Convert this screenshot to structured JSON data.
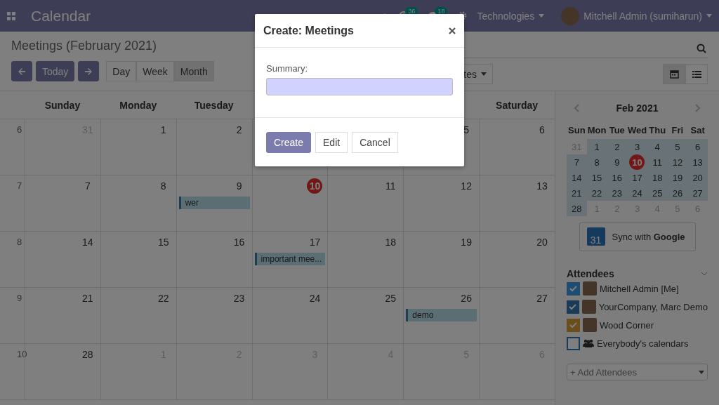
{
  "navbar": {
    "app_title": "Calendar",
    "activity_count": "36",
    "message_count": "18",
    "company": "Technologies",
    "user": "Mitchell Admin (sumiharun)"
  },
  "control_panel": {
    "title": "Meetings (February 2021)",
    "nav_buttons": [
      {
        "kind": "prev"
      },
      {
        "kind": "today",
        "label": "Today"
      },
      {
        "kind": "next"
      }
    ],
    "scales": [
      {
        "label": "Day",
        "selected": false
      },
      {
        "label": "Week",
        "selected": false
      },
      {
        "label": "Month",
        "selected": true
      }
    ],
    "filter_button": "tes",
    "views": [
      {
        "kind": "calendar",
        "selected": true
      },
      {
        "kind": "list",
        "selected": false
      }
    ]
  },
  "calendar": {
    "headers": [
      "Sunday",
      "Monday",
      "Tuesday"
    ],
    "headers_after_gap": [
      "Saturday"
    ],
    "weeks": [
      {
        "number": "6",
        "days": [
          {
            "label": "31",
            "muted": true,
            "today": false
          },
          {
            "label": "1",
            "muted": false,
            "today": false
          },
          {
            "label": "2",
            "muted": false,
            "today": false
          }
        ],
        "days_after_gap": [
          {
            "label": "5",
            "muted": false,
            "today": false
          },
          {
            "label": "6",
            "muted": false,
            "today": false
          }
        ]
      },
      {
        "number": "7",
        "days": [
          {
            "label": "7",
            "muted": false,
            "today": false
          },
          {
            "label": "8",
            "muted": false,
            "today": false
          },
          {
            "label": "9",
            "muted": false,
            "today": false,
            "events": [
              "wer"
            ]
          },
          {
            "label": "10",
            "muted": false,
            "today": true
          },
          {
            "label": "11",
            "muted": false,
            "today": false
          },
          {
            "label": "12",
            "muted": false,
            "today": false
          },
          {
            "label": "13",
            "muted": false,
            "today": false
          }
        ]
      },
      {
        "number": "8",
        "days": [
          {
            "label": "14",
            "muted": false,
            "today": false
          },
          {
            "label": "15",
            "muted": false,
            "today": false
          },
          {
            "label": "16",
            "muted": false,
            "today": false
          },
          {
            "label": "17",
            "muted": false,
            "today": false,
            "events": [
              "important mee..."
            ]
          },
          {
            "label": "18",
            "muted": false,
            "today": false
          },
          {
            "label": "19",
            "muted": false,
            "today": false
          },
          {
            "label": "20",
            "muted": false,
            "today": false
          }
        ]
      },
      {
        "number": "9",
        "days": [
          {
            "label": "21",
            "muted": false,
            "today": false
          },
          {
            "label": "22",
            "muted": false,
            "today": false
          },
          {
            "label": "23",
            "muted": false,
            "today": false
          },
          {
            "label": "24",
            "muted": false,
            "today": false
          },
          {
            "label": "25",
            "muted": false,
            "today": false
          },
          {
            "label": "26",
            "muted": false,
            "today": false,
            "events": [
              "demo"
            ]
          },
          {
            "label": "27",
            "muted": false,
            "today": false
          }
        ]
      },
      {
        "number": "10",
        "days": [
          {
            "label": "28",
            "muted": false,
            "today": false
          },
          {
            "label": "1",
            "muted": true,
            "today": false
          },
          {
            "label": "2",
            "muted": true,
            "today": false
          },
          {
            "label": "3",
            "muted": true,
            "today": false
          },
          {
            "label": "4",
            "muted": true,
            "today": false
          },
          {
            "label": "5",
            "muted": true,
            "today": false
          },
          {
            "label": "6",
            "muted": true,
            "today": false
          }
        ]
      }
    ]
  },
  "sidebar": {
    "mini_calendar": {
      "title": "Feb 2021",
      "weekdays": [
        "Sun",
        "Mon",
        "Tue",
        "Wed",
        "Thu",
        "Fri",
        "Sat"
      ],
      "weeks": [
        [
          {
            "label": "31",
            "muted": true,
            "today": false
          },
          {
            "label": "1",
            "muted": false,
            "today": false
          },
          {
            "label": "2",
            "muted": false,
            "today": false
          },
          {
            "label": "3",
            "muted": false,
            "today": false
          },
          {
            "label": "4",
            "muted": false,
            "today": false
          },
          {
            "label": "5",
            "muted": false,
            "today": false
          },
          {
            "label": "6",
            "muted": false,
            "today": false
          }
        ],
        [
          {
            "label": "7",
            "muted": false,
            "today": false
          },
          {
            "label": "8",
            "muted": false,
            "today": false
          },
          {
            "label": "9",
            "muted": false,
            "today": false
          },
          {
            "label": "10",
            "muted": false,
            "today": true
          },
          {
            "label": "11",
            "muted": false,
            "today": false
          },
          {
            "label": "12",
            "muted": false,
            "today": false
          },
          {
            "label": "13",
            "muted": false,
            "today": false
          }
        ],
        [
          {
            "label": "14",
            "muted": false,
            "today": false
          },
          {
            "label": "15",
            "muted": false,
            "today": false
          },
          {
            "label": "16",
            "muted": false,
            "today": false
          },
          {
            "label": "17",
            "muted": false,
            "today": false
          },
          {
            "label": "18",
            "muted": false,
            "today": false
          },
          {
            "label": "19",
            "muted": false,
            "today": false
          },
          {
            "label": "20",
            "muted": false,
            "today": false
          }
        ],
        [
          {
            "label": "21",
            "muted": false,
            "today": false
          },
          {
            "label": "22",
            "muted": false,
            "today": false
          },
          {
            "label": "23",
            "muted": false,
            "today": false
          },
          {
            "label": "24",
            "muted": false,
            "today": false
          },
          {
            "label": "25",
            "muted": false,
            "today": false
          },
          {
            "label": "26",
            "muted": false,
            "today": false
          },
          {
            "label": "27",
            "muted": false,
            "today": false
          }
        ],
        [
          {
            "label": "28",
            "muted": false,
            "today": false
          },
          {
            "label": "1",
            "muted": true,
            "today": false
          },
          {
            "label": "2",
            "muted": true,
            "today": false
          },
          {
            "label": "3",
            "muted": true,
            "today": false
          },
          {
            "label": "4",
            "muted": true,
            "today": false
          },
          {
            "label": "5",
            "muted": true,
            "today": false
          },
          {
            "label": "6",
            "muted": true,
            "today": false
          }
        ]
      ]
    },
    "sync_icon_day": "31",
    "sync_label": "Sync with **Google**",
    "attendees_title": "Attendees",
    "attendees": [
      {
        "kind": "person",
        "name": "Mitchell Admin [Me]",
        "checked": true,
        "color": "#1d4d73"
      },
      {
        "kind": "person",
        "name": "YourCompany, Marc Demo",
        "checked": true,
        "color": "#1a3a5a"
      },
      {
        "kind": "person",
        "name": "Wood Corner",
        "checked": true,
        "color": "#6b4e1a"
      },
      {
        "kind": "everybody",
        "name": "Everybody's calendars",
        "checked": false,
        "color": "#1a3a5a"
      }
    ],
    "add_attendees_placeholder": "+ Add Attendees"
  },
  "dialog": {
    "title": "Create: Meetings",
    "field_label": "Summary:",
    "buttons": [
      {
        "label": "Create",
        "kind": "primary"
      },
      {
        "label": "Edit",
        "kind": "secondary"
      },
      {
        "label": "Cancel",
        "kind": "secondary"
      }
    ]
  }
}
